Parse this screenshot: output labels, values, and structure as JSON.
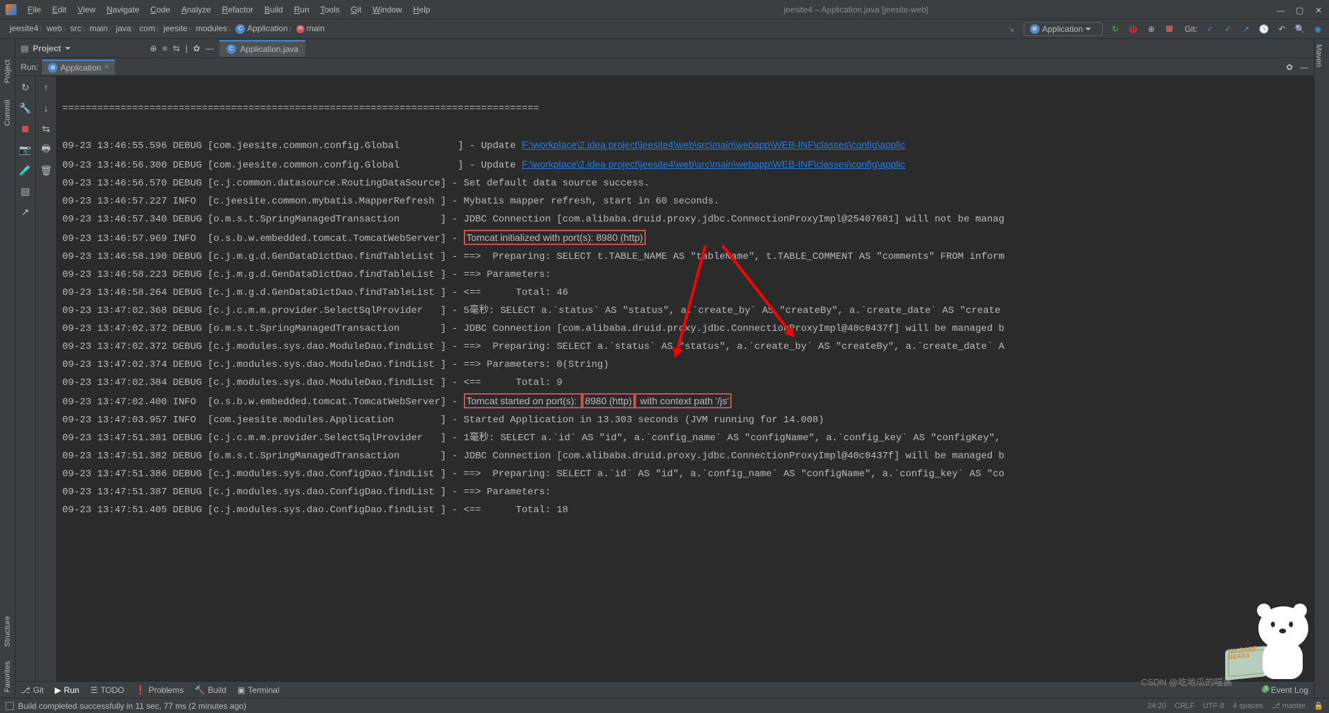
{
  "titlebar": {
    "menus": [
      "File",
      "Edit",
      "View",
      "Navigate",
      "Code",
      "Analyze",
      "Refactor",
      "Build",
      "Run",
      "Tools",
      "Git",
      "Window",
      "Help"
    ],
    "title": "jeesite4 – Application.java [jeesite-web]"
  },
  "breadcrumbs": [
    "jeesite4",
    "web",
    "src",
    "main",
    "java",
    "com",
    "jeesite",
    "modules",
    "Application",
    "main"
  ],
  "run_config": {
    "label": "Application"
  },
  "git_label": "Git:",
  "project_panel": {
    "title": "Project"
  },
  "editor_tab": {
    "label": "Application.java"
  },
  "run_panel": {
    "title": "Run:",
    "tab": "Application"
  },
  "left_sidebar": {
    "project": "Project",
    "commit": "Commit",
    "structure": "Structure",
    "favorites": "Favorites"
  },
  "right_sidebar": {
    "maven": "Maven"
  },
  "console": {
    "separator": "==================================================================================",
    "lines": [
      "09-23 13:46:55.596 DEBUG [com.jeesite.common.config.Global          ] - Update ",
      "09-23 13:46:56.300 DEBUG [com.jeesite.common.config.Global          ] - Update ",
      "09-23 13:46:56.570 DEBUG [c.j.common.datasource.RoutingDataSource] - Set default data source success.",
      "09-23 13:46:57.227 INFO  [c.jeesite.common.mybatis.MapperRefresh ] - Mybatis mapper refresh, start in 60 seconds.",
      "09-23 13:46:57.340 DEBUG [o.m.s.t.SpringManagedTransaction       ] - JDBC Connection [com.alibaba.druid.proxy.jdbc.ConnectionProxyImpl@25407681] will not be manag",
      "09-23 13:46:57.969 INFO  [o.s.b.w.embedded.tomcat.TomcatWebServer] - ",
      "09-23 13:46:58.190 DEBUG [c.j.m.g.d.GenDataDictDao.findTableList ] - ==>  Preparing: SELECT t.TABLE_NAME AS \"tableName\", t.TABLE_COMMENT AS \"comments\" FROM inform",
      "09-23 13:46:58.223 DEBUG [c.j.m.g.d.GenDataDictDao.findTableList ] - ==> Parameters:",
      "09-23 13:46:58.264 DEBUG [c.j.m.g.d.GenDataDictDao.findTableList ] - <==      Total: 46",
      "09-23 13:47:02.368 DEBUG [c.j.c.m.m.provider.SelectSqlProvider   ] - 5毫秒: SELECT a.`status` AS \"status\", a.`create_by` AS \"createBy\", a.`create_date` AS \"create",
      "09-23 13:47:02.372 DEBUG [o.m.s.t.SpringManagedTransaction       ] - JDBC Connection [com.alibaba.druid.proxy.jdbc.ConnectionProxyImpl@40c0437f] will be managed b",
      "09-23 13:47:02.372 DEBUG [c.j.modules.sys.dao.ModuleDao.findList ] - ==>  Preparing: SELECT a.`status` AS \"status\", a.`create_by` AS \"createBy\", a.`create_date` A",
      "09-23 13:47:02.374 DEBUG [c.j.modules.sys.dao.ModuleDao.findList ] - ==> Parameters: 0(String)",
      "09-23 13:47:02.384 DEBUG [c.j.modules.sys.dao.ModuleDao.findList ] - <==      Total: 9",
      "09-23 13:47:02.400 INFO  [o.s.b.w.embedded.tomcat.TomcatWebServer] - ",
      "09-23 13:47:03.957 INFO  [com.jeesite.modules.Application        ] - Started Application in 13.303 seconds (JVM running for 14.008)",
      "09-23 13:47:51.381 DEBUG [c.j.c.m.m.provider.SelectSqlProvider   ] - 1毫秒: SELECT a.`id` AS \"id\", a.`config_name` AS \"configName\", a.`config_key` AS \"configKey\",",
      "09-23 13:47:51.382 DEBUG [o.m.s.t.SpringManagedTransaction       ] - JDBC Connection [com.alibaba.druid.proxy.jdbc.ConnectionProxyImpl@40c0437f] will be managed b",
      "09-23 13:47:51.386 DEBUG [c.j.modules.sys.dao.ConfigDao.findList ] - ==>  Preparing: SELECT a.`id` AS \"id\", a.`config_name` AS \"configName\", a.`config_key` AS \"co",
      "09-23 13:47:51.387 DEBUG [c.j.modules.sys.dao.ConfigDao.findList ] - ==> Parameters:",
      "09-23 13:47:51.405 DEBUG [c.j.modules.sys.dao.ConfigDao.findList ] - <==      Total: 18"
    ],
    "link": "F:\\workplace\\2.idea project\\jeesite4\\web\\src\\main\\webapp\\WEB-INF\\classes\\config\\applic",
    "hl1": "Tomcat initialized with port(s): 8980 (http)",
    "hl2a": "Tomcat started on port(s): ",
    "hl2b": "8980 (http)",
    "hl2c": " with context path '/js'"
  },
  "bottom_tabs": {
    "git": "Git",
    "run": "Run",
    "todo": "TODO",
    "problems": "Problems",
    "build": "Build",
    "terminal": "Terminal",
    "event_log": "Event Log",
    "event_badge": "1"
  },
  "status": {
    "msg": "Build completed successfully in 11 sec, 77 ms (2 minutes ago)",
    "pos": "24:20",
    "crlf": "CRLF",
    "enc": "UTF-8",
    "spaces": "4 spaces",
    "branch": "master"
  },
  "watermark": "CSDN @吃地瓜的喵酱",
  "mascot_tag": "We BARE BEARS"
}
